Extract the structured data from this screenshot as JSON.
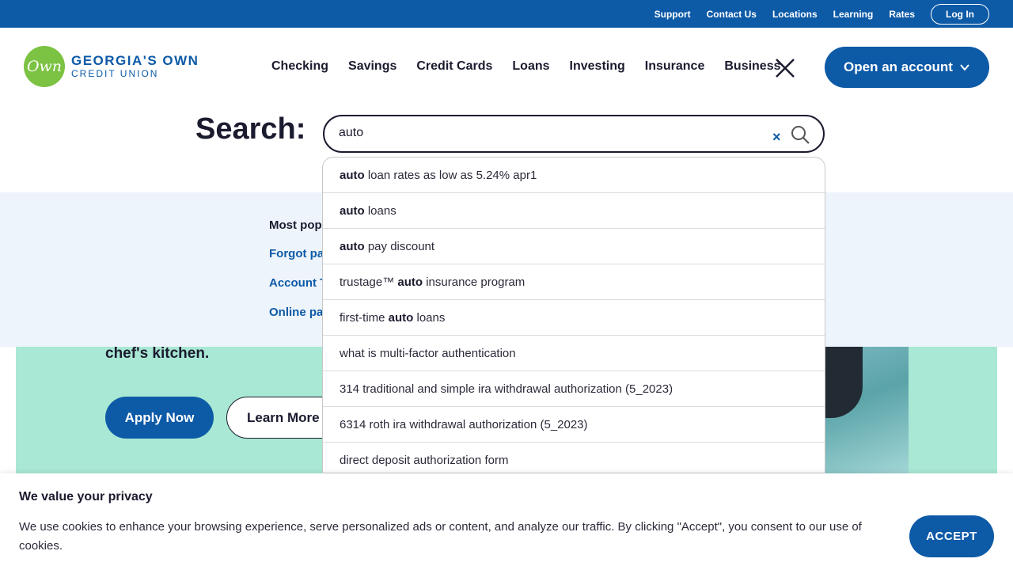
{
  "topbar": {
    "links": [
      "Support",
      "Contact Us",
      "Locations",
      "Learning",
      "Rates"
    ],
    "login_label": "Log In"
  },
  "logo": {
    "mark": "Own",
    "line1": "GEORGIA'S OWN",
    "line2": "CREDIT UNION"
  },
  "nav": {
    "items": [
      "Checking",
      "Savings",
      "Credit Cards",
      "Loans",
      "Investing",
      "Insurance",
      "Business"
    ]
  },
  "open_account_label": "Open an account",
  "search": {
    "label": "Search:",
    "value": "auto"
  },
  "suggestions": [
    {
      "pre": "",
      "bold": "auto",
      "post": " loan rates as low as 5.24% apr1"
    },
    {
      "pre": "",
      "bold": "auto",
      "post": " loans"
    },
    {
      "pre": "",
      "bold": "auto",
      "post": " pay discount"
    },
    {
      "pre": "trustage™ ",
      "bold": "auto",
      "post": " insurance program"
    },
    {
      "pre": "first-time ",
      "bold": "auto",
      "post": " loans"
    },
    {
      "pre": "what is multi-factor authentication",
      "bold": "",
      "post": ""
    },
    {
      "pre": "314 traditional and simple ira withdrawal authorization (5_2023)",
      "bold": "",
      "post": ""
    },
    {
      "pre": "6314 roth ira withdrawal authorization (5_2023)",
      "bold": "",
      "post": ""
    },
    {
      "pre": "direct deposit authorization form",
      "bold": "",
      "post": ""
    }
  ],
  "popular": {
    "heading": "Most pop",
    "links": [
      "Forgot pa",
      "Account T",
      "Online pa"
    ]
  },
  "hero": {
    "text": "chef's kitchen.",
    "apply_label": "Apply Now",
    "learn_label": "Learn More"
  },
  "cookie": {
    "title": "We value your privacy",
    "body": "We use cookies to enhance your browsing experience, serve personalized ads or content, and analyze our traffic. By clicking \"Accept\", you consent to our use of cookies.",
    "accept_label": "ACCEPT"
  },
  "colors": {
    "brand_blue": "#0d5aa7",
    "brand_green": "#7cc243",
    "hero_mint": "#a9e8d4"
  }
}
